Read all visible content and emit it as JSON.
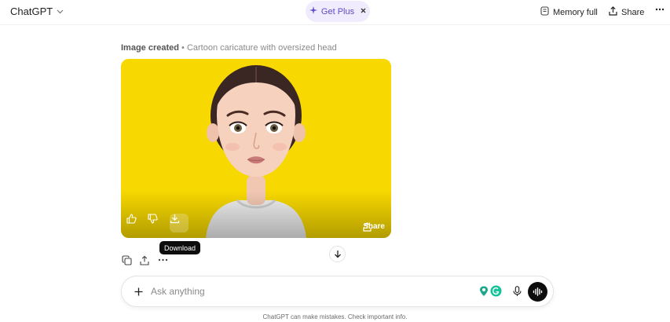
{
  "header": {
    "app_title": "ChatGPT",
    "get_plus_label": "Get Plus",
    "memory_label": "Memory full",
    "share_label": "Share"
  },
  "message": {
    "created_status": "Image created",
    "created_separator": " • ",
    "created_description": "Cartoon caricature with oversized head"
  },
  "image_card": {
    "share_label": "Share",
    "background_color": "#f7d800"
  },
  "tooltip": {
    "download_label": "Download"
  },
  "composer": {
    "placeholder": "Ask anything"
  },
  "footer": {
    "disclaimer": "ChatGPT can make mistakes. Check important info."
  },
  "colors": {
    "accent_purple": "#5d4bc7",
    "plus_bg": "#f0ecfd",
    "grammarly_green": "#15c39a"
  }
}
